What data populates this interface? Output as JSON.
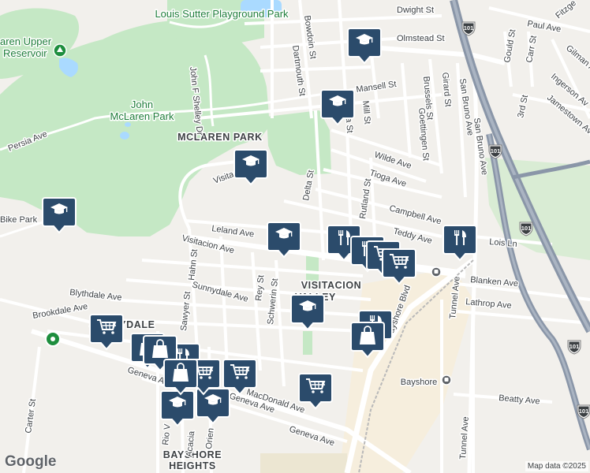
{
  "map": {
    "brand": "Google",
    "attribution": "Map data ©2025",
    "colors": {
      "background": "#f2f0ec",
      "park": "#c5e8c5",
      "water": "#aadaff",
      "highway": "#8a96a8",
      "road": "#ffffff",
      "marker": "#2b4b6b",
      "transit": "#5f6368"
    },
    "labels": {
      "louis_sutter": "Louis Sutter Playground Park",
      "upper_reservoir_1": "aren Upper",
      "upper_reservoir_2": "Reservoir",
      "john_mclaren_1": "John",
      "john_mclaren_2": "McLaren Park",
      "mclaren_park": "MCLAREN PARK",
      "visitacion_valley_1": "VISITACION",
      "visitacion_valley_2": "VALLEY",
      "sunnydale": "SUNNYDALE",
      "bayshore_heights_1": "BAYSHORE",
      "bayshore_heights_2": "HEIGHTS",
      "bayshore_station": "Bayshore",
      "bike_park": "Bike Park"
    },
    "streets": {
      "dwight": "Dwight St",
      "olmstead": "Olmstead St",
      "bowdoin": "Bowdoin St",
      "dartmouth": "Dartmouth St",
      "mansell": "Mansell St",
      "john_f_shelley": "John F Shelley Dr",
      "persia": "Persia Ave",
      "visitacion_park": "Visitacion Ave",
      "brussels": "Brussels St",
      "girard": "Girard St",
      "goettingen": "Goettingen St",
      "delta_n": "Delta St",
      "mill": "Mill St",
      "wilde": "Wilde Ave",
      "tioga": "Tioga Ave",
      "campbell": "Campbell Ave",
      "teddy": "Teddy Ave",
      "leland": "Leland Ave",
      "delta_s": "Delta St",
      "rutland": "Rutland St",
      "visitacion_main": "Visitacion Ave",
      "hahn": "Hahn St",
      "sawyer": "Sawyer St",
      "sunnydale_ave": "Sunnydale Ave",
      "rey": "Rey St",
      "schwerin": "Schwerin St",
      "blythdale": "Blythdale Ave",
      "brookdale": "Brookdale Ave",
      "geneva_1": "Geneva Ave",
      "geneva_2": "Geneva Ave",
      "carter": "Carter St",
      "macdonald": "MacDonald Ave",
      "rio_verde": "Rio V",
      "acacia": "Acacia",
      "orient": "Orien",
      "bayshore_blvd": "Bayshore Blvd",
      "san_bruno_1": "San Bruno Ave",
      "san_bruno_2": "San Bruno Ave",
      "tunnel_1": "Tunnel Ave",
      "tunnel_2": "Tunnel Ave",
      "blanken": "Blanken Ave",
      "lathrop": "Lathrop Ave",
      "lois": "Lois Ln",
      "beatty": "Beatty Ave",
      "paul": "Paul Ave",
      "gould": "Gould St",
      "carr": "Carr St",
      "gilman": "Gilman A",
      "ingerson": "Ingerson Av",
      "jamestown": "Jamestown Ave",
      "third": "3rd St",
      "fitzgerald": "Fitzge"
    },
    "shields": [
      "101",
      "101",
      "101",
      "101",
      "101"
    ],
    "markers": [
      {
        "type": "school-icon"
      },
      {
        "type": "school-icon"
      },
      {
        "type": "school-icon"
      },
      {
        "type": "school-icon"
      },
      {
        "type": "school-icon"
      },
      {
        "type": "school-icon"
      },
      {
        "type": "school-icon"
      },
      {
        "type": "school-icon"
      },
      {
        "type": "restaurant-icon"
      },
      {
        "type": "restaurant-icon"
      },
      {
        "type": "restaurant-icon"
      },
      {
        "type": "grocery-icon"
      },
      {
        "type": "grocery-icon"
      },
      {
        "type": "grocery-icon"
      },
      {
        "type": "grocery-icon"
      },
      {
        "type": "grocery-icon"
      },
      {
        "type": "shopping-icon"
      },
      {
        "type": "shopping-icon"
      },
      {
        "type": "shopping-icon"
      }
    ]
  }
}
